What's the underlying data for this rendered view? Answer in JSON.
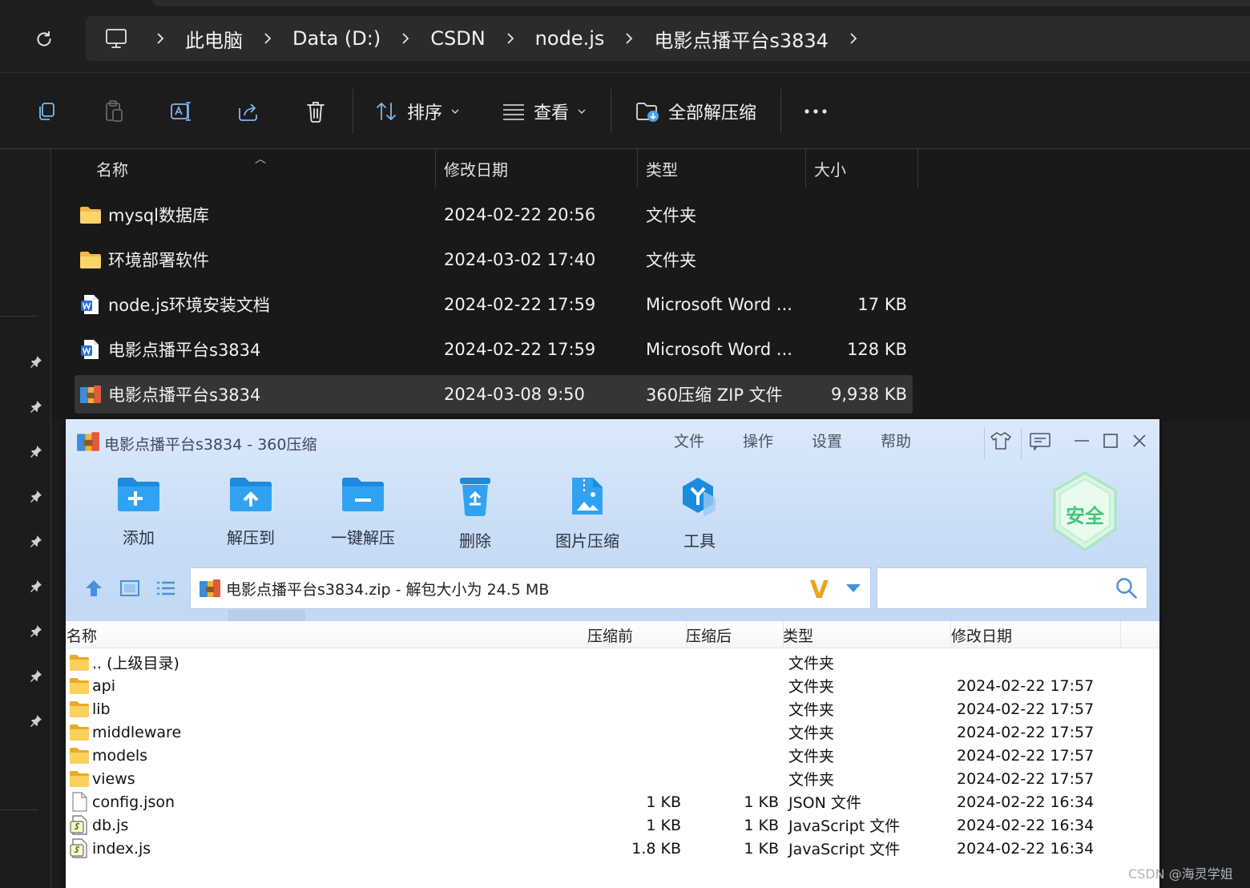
{
  "explorer": {
    "breadcrumb": [
      "此电脑",
      "Data (D:)",
      "CSDN",
      "node.js",
      "电影点播平台s3834"
    ],
    "toolbar": {
      "sort_label": "排序",
      "view_label": "查看",
      "extract_all_label": "全部解压缩"
    },
    "columns": {
      "name": "名称",
      "modified": "修改日期",
      "type": "类型",
      "size": "大小"
    },
    "files": [
      {
        "name": "mysql数据库",
        "modified": "2024-02-22 20:56",
        "type": "文件夹",
        "size": "",
        "icon": "folder-icon"
      },
      {
        "name": "环境部署软件",
        "modified": "2024-03-02 17:40",
        "type": "文件夹",
        "size": "",
        "icon": "folder-icon"
      },
      {
        "name": "node.js环境安装文档",
        "modified": "2024-02-22 17:59",
        "type": "Microsoft Word ...",
        "size": "17 KB",
        "icon": "word-doc-icon"
      },
      {
        "name": "电影点播平台s3834",
        "modified": "2024-02-22 17:59",
        "type": "Microsoft Word ...",
        "size": "128 KB",
        "icon": "word-doc-icon"
      },
      {
        "name": "电影点播平台s3834",
        "modified": "2024-03-08 9:50",
        "type": "360压缩 ZIP 文件",
        "size": "9,938 KB",
        "icon": "zip-archive-icon",
        "selected": true
      }
    ]
  },
  "zip": {
    "title": "电影点播平台s3834 - 360压缩",
    "menu": [
      "文件",
      "操作",
      "设置",
      "帮助"
    ],
    "tools": [
      "添加",
      "解压到",
      "一键解压",
      "删除",
      "图片压缩",
      "工具"
    ],
    "safe_badge": "安全",
    "path_text": "电影点播平台s3834.zip - 解包大小为 24.5 MB",
    "search_value": "",
    "columns": {
      "name": "名称",
      "before": "压缩前",
      "after": "压缩后",
      "type": "类型",
      "modified": "修改日期"
    },
    "rows": [
      {
        "name": ".. (上级目录)",
        "before": "",
        "after": "",
        "type": "文件夹",
        "modified": "",
        "icon": "folder-icon"
      },
      {
        "name": "api",
        "before": "",
        "after": "",
        "type": "文件夹",
        "modified": "2024-02-22 17:57",
        "icon": "folder-icon"
      },
      {
        "name": "lib",
        "before": "",
        "after": "",
        "type": "文件夹",
        "modified": "2024-02-22 17:57",
        "icon": "folder-icon"
      },
      {
        "name": "middleware",
        "before": "",
        "after": "",
        "type": "文件夹",
        "modified": "2024-02-22 17:57",
        "icon": "folder-icon"
      },
      {
        "name": "models",
        "before": "",
        "after": "",
        "type": "文件夹",
        "modified": "2024-02-22 17:57",
        "icon": "folder-icon"
      },
      {
        "name": "views",
        "before": "",
        "after": "",
        "type": "文件夹",
        "modified": "2024-02-22 17:57",
        "icon": "folder-icon"
      },
      {
        "name": "config.json",
        "before": "1 KB",
        "after": "1 KB",
        "type": "JSON 文件",
        "modified": "2024-02-22 16:34",
        "icon": "blank-file-icon"
      },
      {
        "name": "db.js",
        "before": "1 KB",
        "after": "1 KB",
        "type": "JavaScript 文件",
        "modified": "2024-02-22 16:34",
        "icon": "script-file-icon"
      },
      {
        "name": "index.js",
        "before": "1.8 KB",
        "after": "1 KB",
        "type": "JavaScript 文件",
        "modified": "2024-02-22 16:34",
        "icon": "script-file-icon"
      }
    ]
  },
  "watermark": "CSDN @海灵学姐",
  "colors": {
    "explorer_bg": "#1c1c1c",
    "selected_row": "#353535",
    "zip_header": "#c8dcf6",
    "zip_accent": "#1b8be0",
    "safe_green": "#3cc97a"
  }
}
